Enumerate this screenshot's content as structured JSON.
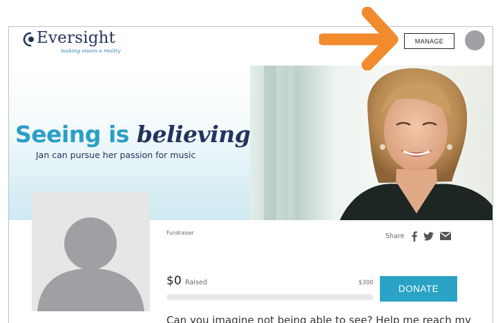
{
  "header": {
    "logo_word": "Eversight",
    "logo_tagline": "making vision a reality",
    "manage_label": "MANAGE"
  },
  "banner": {
    "title_plain": "Seeing is",
    "title_emphasis": "believing",
    "subtitle": "Jan can pursue her passion for music"
  },
  "campaign": {
    "type_label": "Fundraiser",
    "share_label": "Share",
    "raised_amount": "$0",
    "raised_label": "Raised",
    "goal": "$300",
    "progress_fraction": 0,
    "donate_label": "DONATE",
    "story_preview": "Can you imagine not being able to see? Help me reach my"
  },
  "icons": {
    "logo": "eye-logo-icon",
    "share": [
      "facebook-icon",
      "twitter-icon",
      "email-icon"
    ],
    "annotation": "arrow-right-icon"
  },
  "colors": {
    "brand_navy": "#23345d",
    "brand_blue": "#2a9fc5",
    "donate_button": "#2aa3c6",
    "annotation_arrow": "#f28a2e",
    "placeholder_gray": "#9ea0a3"
  }
}
